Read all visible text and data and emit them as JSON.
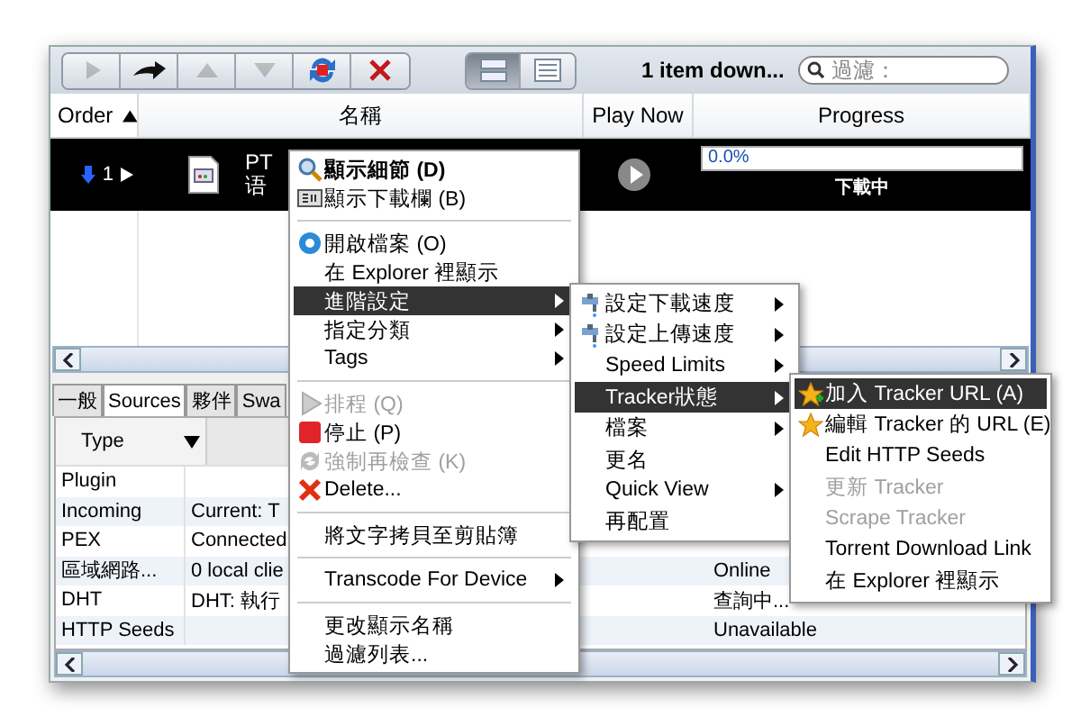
{
  "toolbar": {
    "buttons": [
      {
        "kind": "play",
        "disabled": true
      },
      {
        "kind": "move",
        "disabled": false
      },
      {
        "kind": "up",
        "disabled": true
      },
      {
        "kind": "down",
        "disabled": true
      },
      {
        "kind": "refresh",
        "disabled": false
      },
      {
        "kind": "remove",
        "disabled": false
      }
    ],
    "views": [
      {
        "kind": "detail",
        "selected": true
      },
      {
        "kind": "list",
        "selected": false
      }
    ],
    "status": "1 item down...",
    "filter": {
      "placeholder": "過濾："
    }
  },
  "columns": [
    {
      "label": "Order",
      "sorted": true
    },
    {
      "label": "名稱",
      "sorted": false
    },
    {
      "label": "Play Now",
      "sorted": false
    },
    {
      "label": "Progress",
      "sorted": false
    }
  ],
  "download": {
    "order": "1",
    "name_lines": [
      "PT",
      "语"
    ],
    "level": 0,
    "percent": "0.0%",
    "status": "下載中"
  },
  "tabs": [
    {
      "label": "一般",
      "selected": false
    },
    {
      "label": "Sources",
      "selected": true
    },
    {
      "label": "夥伴",
      "selected": false
    },
    {
      "label": "Swa",
      "selected": false
    }
  ],
  "sources": {
    "columns": [
      "Type"
    ],
    "rows": [
      {
        "type": "Plugin"
      },
      {
        "type": "Incoming",
        "detail": "Current: T"
      },
      {
        "type": "PEX",
        "detail": "Connected"
      },
      {
        "type": "區域網路...",
        "detail": "0 local clie",
        "status": "Online"
      },
      {
        "type": "DHT",
        "detail": "DHT: 執行",
        "status": "查詢中..."
      },
      {
        "type": "HTTP Seeds",
        "status": "Unavailable"
      }
    ]
  },
  "context_menu": [
    {
      "kind": "magnifier",
      "label": "顯示細節 (D)",
      "bold": true,
      "disabled": false,
      "submenu": false,
      "selected": false
    },
    {
      "kind": "bar",
      "label": "顯示下載欄 (B)",
      "bold": false,
      "disabled": false,
      "submenu": false,
      "selected": false
    },
    {
      "kind": "separator"
    },
    {
      "kind": "open",
      "label": "開啟檔案 (O)",
      "bold": false,
      "disabled": false,
      "submenu": false,
      "selected": false
    },
    {
      "kind": "plain",
      "label": "在 Explorer 裡顯示",
      "bold": false,
      "disabled": false,
      "submenu": false,
      "selected": false
    },
    {
      "kind": "plain",
      "label": "進階設定",
      "bold": false,
      "disabled": false,
      "submenu": true,
      "selected": true
    },
    {
      "kind": "plain",
      "label": "指定分類",
      "bold": false,
      "disabled": false,
      "submenu": true,
      "selected": false
    },
    {
      "kind": "plain",
      "label": "Tags",
      "bold": false,
      "disabled": false,
      "submenu": true,
      "selected": false
    },
    {
      "kind": "separator"
    },
    {
      "kind": "play",
      "label": "排程 (Q)",
      "bold": false,
      "disabled": true,
      "submenu": false,
      "selected": false
    },
    {
      "kind": "stop",
      "label": "停止 (P)",
      "bold": false,
      "disabled": false,
      "submenu": false,
      "selected": false
    },
    {
      "kind": "recheck",
      "label": "強制再檢查 (K)",
      "bold": false,
      "disabled": true,
      "submenu": false,
      "selected": false
    },
    {
      "kind": "delete",
      "label": "Delete...",
      "bold": false,
      "disabled": false,
      "submenu": false,
      "selected": false
    },
    {
      "kind": "separator"
    },
    {
      "kind": "plain",
      "label": "將文字拷貝至剪貼簿",
      "bold": false,
      "disabled": false,
      "submenu": false,
      "selected": false
    },
    {
      "kind": "separator"
    },
    {
      "kind": "plain",
      "label": "Transcode For Device",
      "bold": false,
      "disabled": false,
      "submenu": true,
      "selected": false
    },
    {
      "kind": "separator"
    },
    {
      "kind": "plain",
      "label": "更改顯示名稱",
      "bold": false,
      "disabled": false,
      "submenu": false,
      "selected": false
    },
    {
      "kind": "plain",
      "label": "過濾列表...",
      "bold": false,
      "disabled": false,
      "submenu": false,
      "selected": false
    }
  ],
  "advanced_menu": [
    {
      "kind": "speed",
      "label": "設定下載速度",
      "disabled": false,
      "submenu": true,
      "selected": false
    },
    {
      "kind": "speed",
      "label": "設定上傳速度",
      "disabled": false,
      "submenu": true,
      "selected": false
    },
    {
      "kind": "plain",
      "label": "Speed Limits",
      "disabled": false,
      "submenu": true,
      "selected": false
    },
    {
      "kind": "plain",
      "label": "Tracker狀態",
      "disabled": false,
      "submenu": true,
      "selected": true
    },
    {
      "kind": "plain",
      "label": "檔案",
      "disabled": false,
      "submenu": true,
      "selected": false
    },
    {
      "kind": "plain",
      "label": "更名",
      "disabled": false,
      "submenu": false,
      "selected": false
    },
    {
      "kind": "plain",
      "label": "Quick View",
      "disabled": false,
      "submenu": true,
      "selected": false
    },
    {
      "kind": "plain",
      "label": "再配置",
      "disabled": false,
      "submenu": false,
      "selected": false
    }
  ],
  "tracker_menu": [
    {
      "kind": "star-add",
      "label": "加入 Tracker URL (A)",
      "disabled": false,
      "selected": true
    },
    {
      "kind": "star",
      "label": "編輯 Tracker 的 URL (E)",
      "disabled": false,
      "selected": false
    },
    {
      "kind": "plain",
      "label": "Edit HTTP Seeds",
      "disabled": false,
      "selected": false
    },
    {
      "kind": "plain",
      "label": "更新 Tracker",
      "disabled": true,
      "selected": false
    },
    {
      "kind": "plain",
      "label": "Scrape Tracker",
      "disabled": true,
      "selected": false
    },
    {
      "kind": "plain",
      "label": "Torrent Download Link",
      "disabled": false,
      "selected": false
    },
    {
      "kind": "plain",
      "label": "在 Explorer 裡顯示",
      "disabled": false,
      "selected": false
    }
  ]
}
